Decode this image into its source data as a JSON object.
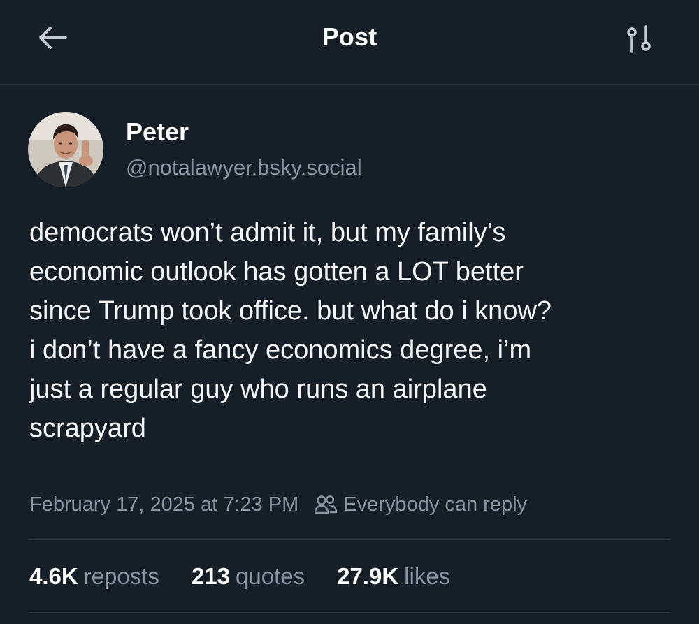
{
  "header": {
    "title": "Post",
    "back_icon": "arrow-left-icon",
    "settings_icon": "thread-settings-icon"
  },
  "author": {
    "display_name": "Peter",
    "handle": "@notalawyer.bsky.social"
  },
  "post": {
    "text": "democrats won’t admit it, but my family’s\neconomic outlook has gotten a LOT better\nsince Trump took office. but what do i know?\ni don’t have a fancy economics degree, i’m\njust a regular guy who runs an airplane\nscrapyard"
  },
  "meta": {
    "timestamp": "February 17, 2025 at 7:23 PM",
    "reply_icon": "people-icon",
    "reply_setting": "Everybody can reply"
  },
  "stats": {
    "reposts_count": "4.6K",
    "reposts_label": "reposts",
    "quotes_count": "213",
    "quotes_label": "quotes",
    "likes_count": "27.9K",
    "likes_label": "likes"
  },
  "colors": {
    "background": "#161e27",
    "text_primary": "#ffffff",
    "text_secondary": "#8a95a3",
    "divider": "#2b3440"
  }
}
